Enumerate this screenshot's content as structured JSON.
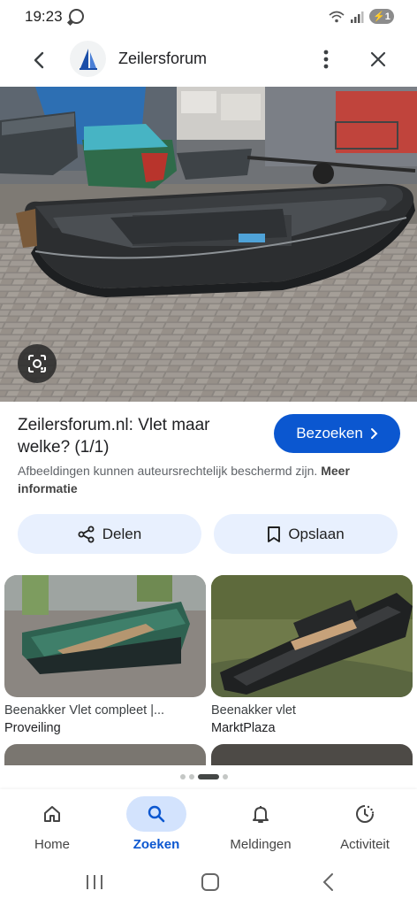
{
  "status_bar": {
    "time": "19:23",
    "battery_label": "1",
    "icons": [
      "whatsapp-icon",
      "wifi-icon",
      "signal-icon",
      "battery-icon"
    ]
  },
  "header": {
    "title": "Zeilersforum",
    "icons": [
      "back-arrow-icon",
      "site-logo-icon",
      "more-vert-icon",
      "close-icon"
    ]
  },
  "result": {
    "title": "Zeilersforum.nl: Vlet maar welke? (1/1)",
    "visit_label": "Bezoeken",
    "copyright_text": "Afbeeldingen kunnen auteursrechtelijk beschermd zijn.",
    "more_info_label": "Meer informatie",
    "share_label": "Delen",
    "save_label": "Opslaan"
  },
  "related": [
    {
      "title": "Beenakker Vlet compleet |...",
      "source": "Proveiling"
    },
    {
      "title": "Beenakker vlet",
      "source": "MarktPlaza"
    }
  ],
  "bottom_nav": [
    {
      "label": "Home",
      "icon": "home-icon"
    },
    {
      "label": "Zoeken",
      "icon": "search-icon",
      "active": true
    },
    {
      "label": "Meldingen",
      "icon": "bell-icon"
    },
    {
      "label": "Activiteit",
      "icon": "activity-icon"
    }
  ],
  "colors": {
    "accent": "#0b57d0",
    "chip_bg": "#e8f0fe",
    "active_nav_bg": "#d3e3fd"
  }
}
